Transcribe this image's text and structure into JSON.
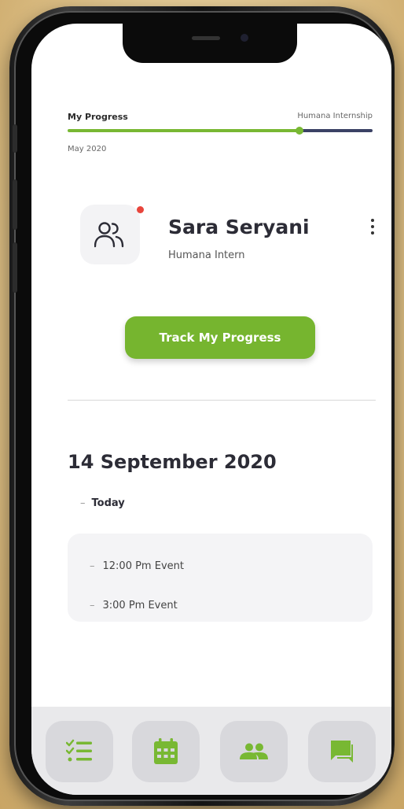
{
  "progress": {
    "left_label": "My Progress",
    "right_label": "Humana Internship",
    "date": "May 2020",
    "fraction": 0.76,
    "colors": {
      "complete": "#78b833",
      "remaining": "#3b4265"
    }
  },
  "profile": {
    "name": "Sara Seryani",
    "role": "Humana Intern",
    "avatar_icon": "people-outline-icon",
    "has_notification": true,
    "notification_color": "#e8453c"
  },
  "actions": {
    "track_label": "Track My Progress",
    "accent_color": "#76b52f"
  },
  "schedule": {
    "date": "14 September 2020",
    "today_label": "Today",
    "events": [
      "12:00 Pm Event",
      "3:00 Pm Event"
    ]
  },
  "nav": {
    "items": [
      {
        "icon": "checklist-icon"
      },
      {
        "icon": "calendar-icon"
      },
      {
        "icon": "group-icon"
      },
      {
        "icon": "chat-icon"
      }
    ]
  }
}
